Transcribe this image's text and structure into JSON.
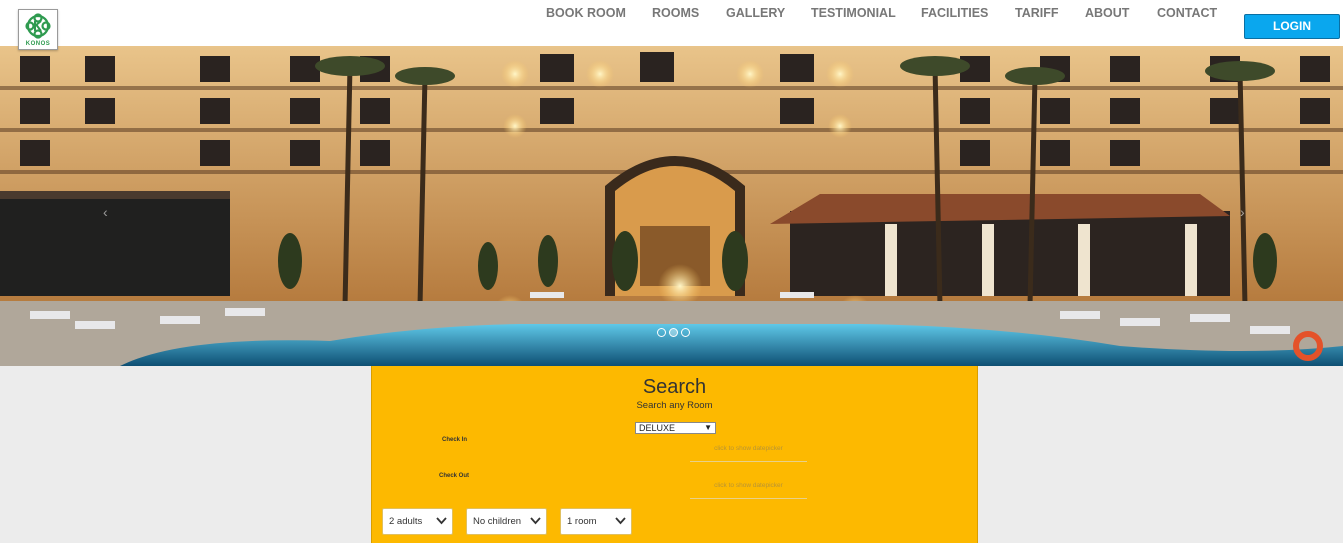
{
  "brand": {
    "logo_text": "KONOS"
  },
  "nav": {
    "items": [
      "BOOK ROOM",
      "ROOMS",
      "GALLERY",
      "TESTIMONIAL",
      "FACILITIES",
      "TARIFF",
      "ABOUT",
      "CONTACT"
    ],
    "login_label": "LOGIN"
  },
  "hero": {
    "slide_count": 3,
    "active_slide": 1,
    "prev_arrow": "‹",
    "next_arrow": "›"
  },
  "search": {
    "title": "Search",
    "subtitle": "Search any Room",
    "room_type": "DELUXE",
    "check_in_label": "Check In",
    "check_out_label": "Check Out",
    "check_in_placeholder": "click to show datepicker",
    "check_out_placeholder": "click to show datepicker",
    "adults": "2 adults",
    "children": "No children",
    "rooms": "1 room"
  },
  "colors": {
    "accent": "#fdb900",
    "login": "#0aa7ee",
    "nav_text": "#777777"
  }
}
